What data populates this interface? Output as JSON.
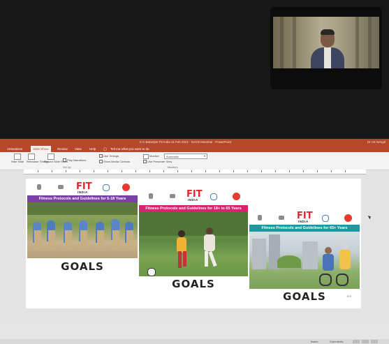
{
  "video": {
    "participant_tile": "presenter-video"
  },
  "powerpoint": {
    "title": "K K Banerjee Fit India 11 Feb 2021 · NAOH Mumbai · PowerPoint",
    "user": "Dr AK Nergul",
    "tabs": [
      "Animations",
      "Slide Show",
      "Review",
      "View",
      "Help"
    ],
    "active_tab": "Slide Show",
    "tell_me": "Tell me what you want to do",
    "ribbon": {
      "hide_slide": "Hide Slide",
      "rehearse": "Rehearse Timings",
      "record": "Record Slide Show",
      "play_narrations": "Play Narrations",
      "use_timings": "Use Timings",
      "show_media_controls": "Show Media Controls",
      "monitor_label": "Monitor:",
      "monitor_value": "Automatic",
      "use_presenter_view": "Use Presenter View",
      "group_setup": "Set Up",
      "group_monitors": "Monitors"
    },
    "status": {
      "notes": "Notes",
      "comments": "Comments"
    }
  },
  "slide": {
    "posters": [
      {
        "fit": "FIT",
        "india": "INDIA",
        "band": "Fitness Protocols and Guidelines for 5-18 Years",
        "band_color": "#7b3fa8",
        "goals": "GOALS"
      },
      {
        "fit": "FIT",
        "india": "INDIA",
        "band": "Fitness Protocols and Guidelines for 18+ to 65 Years",
        "band_color": "#d6246e",
        "goals": "GOALS"
      },
      {
        "fit": "FIT",
        "india": "INDIA",
        "band": "Fitness Protocols and Guidelines for 65+ Years",
        "band_color": "#1c9aa0",
        "goals": "GOALS",
        "page_no": "5.5"
      }
    ]
  },
  "colors": {
    "ppt_accent": "#b7472a",
    "fit_red": "#e4262c"
  }
}
